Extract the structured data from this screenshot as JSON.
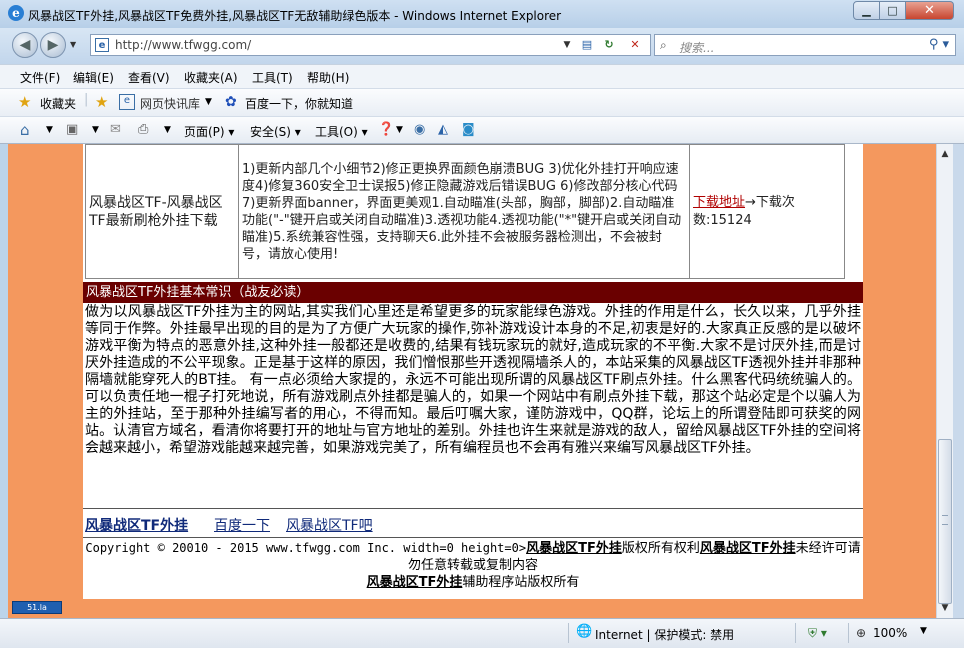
{
  "window": {
    "title": "风暴战区TF外挂,风暴战区TF免费外挂,风暴战区TF无敌辅助绿色版本 - Windows Internet Explorer"
  },
  "nav": {
    "address": "http://www.tfwgg.com/",
    "search_placeholder": "搜索..."
  },
  "menu": [
    "文件(F)",
    "编辑(E)",
    "查看(V)",
    "收藏夹(A)",
    "工具(T)",
    "帮助(H)"
  ],
  "favorites": {
    "favorites_label": "收藏夹",
    "webslice_label": "网页快讯库",
    "baidu_label": "百度一下，你就知道"
  },
  "commandbar": {
    "page_label": "页面(P)",
    "safety_label": "安全(S)",
    "tools_label": "工具(O)"
  },
  "download_row": {
    "name": "风暴战区TF-风暴战区TF最新刷枪外挂下载",
    "description": "1)更新内部几个小细节2)修正更换界面颜色崩溃BUG 3)优化外挂打开响应速度4)修复360安全卫士误报5)修正隐藏游戏后错误BUG 6)修改部分核心代码7)更新界面banner，界面更美观1.自动瞄准(头部，胸部，脚部)2.自动瞄准功能(\"-\"键开启或关闭自动瞄准)3.透视功能4.透视功能(\"*\"键开启或关闭自动瞄准)5.系统兼容性强，支持聊天6.此外挂不会被服务器检测出，不会被封号，请放心使用!",
    "link_text": "下载地址",
    "arrow": "→",
    "count_label": "下载次数:",
    "count": "15124"
  },
  "section": {
    "header": "风暴战区TF外挂基本常识（战友必读）",
    "body": "做为以风暴战区TF外挂为主的网站,其实我们心里还是希望更多的玩家能绿色游戏。外挂的作用是什么，长久以来，几乎外挂等同于作弊。外挂最早出现的目的是为了方便广大玩家的操作,弥补游戏设计本身的不足,初衷是好的.大家真正反感的是以破坏游戏平衡为特点的恶意外挂,这种外挂一般都还是收费的,结果有钱玩家玩的就好,造成玩家的不平衡.大家不是讨厌外挂,而是讨厌外挂造成的不公平现象。正是基于这样的原因，我们憎恨那些开透视隔墙杀人的，本站采集的风暴战区TF透视外挂并非那种隔墙就能穿死人的BT挂。 有一点必须给大家提的，永远不可能出现所谓的风暴战区TF刷点外挂。什么黑客代码统统骗人的。可以负责任地一棍子打死地说，所有游戏刷点外挂都是骗人的，如果一个网站中有刷点外挂下载，那这个站必定是个以骗人为主的外挂站，至于那种外挂编写者的用心，不得而知。最后叮嘱大家，谨防游戏中，QQ群，论坛上的所谓登陆即可获奖的网站。认清官方域名，看清你将要打开的地址与官方地址的差别。外挂也许生来就是游戏的敌人，留给风暴战区TF外挂的空间将会越来越小，希望游戏能越来越完善，如果游戏完美了，所有编程员也不会再有雅兴来编写风暴战区TF外挂。"
  },
  "links": [
    "风暴战区TF外挂",
    "百度一下",
    "风暴战区TF吧"
  ],
  "footer": {
    "copyright": "Copyright © 20010 - 2015 www.tfwgg.com Inc. width=0 height=0>",
    "brand": "风暴战区TF外挂",
    "rights_mid": "版权所有权利",
    "brand2": "风暴战区TF外挂",
    "notice": "未经许可请勿任意转载或复制内容",
    "brand3": "风暴战区TF外挂",
    "notice2": "辅助程序站版权所有"
  },
  "counter_badge": "51.la",
  "status": {
    "zone": "Internet | 保护模式: 禁用",
    "zoom": "100%"
  }
}
